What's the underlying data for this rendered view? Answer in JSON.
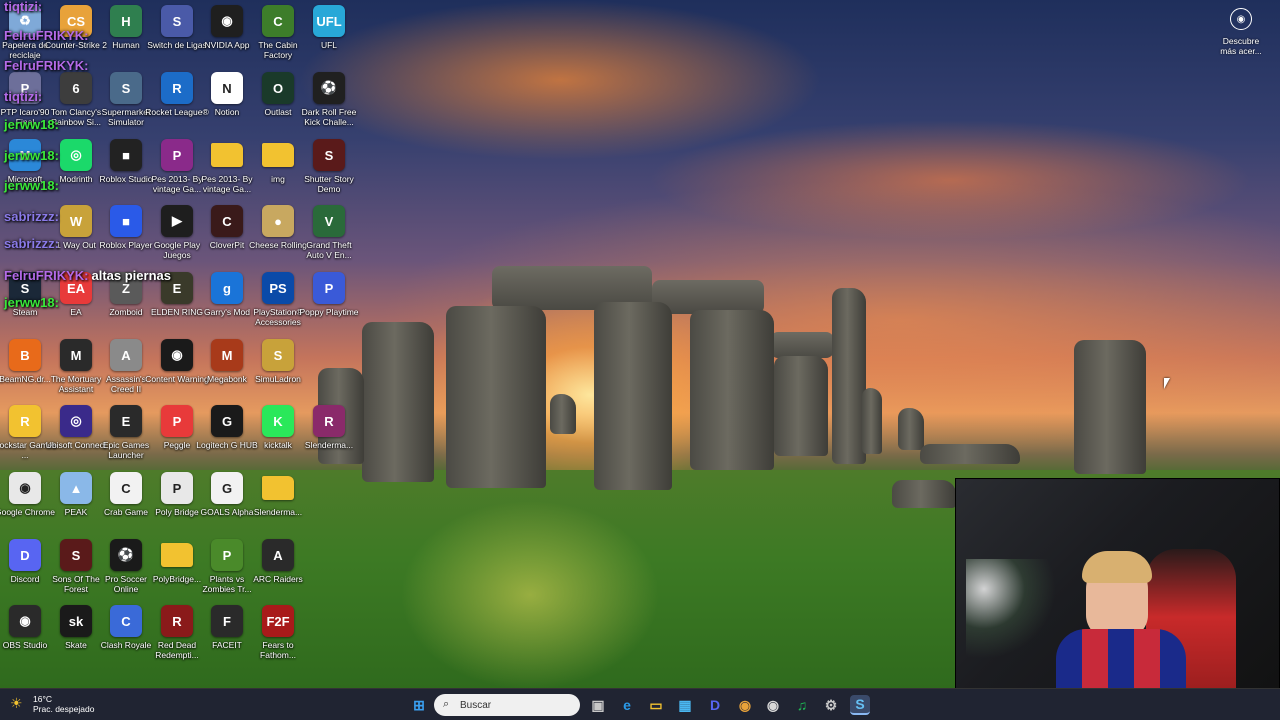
{
  "desktop": {
    "icons": [
      {
        "label": "Papelera de reciclaje",
        "icon": "recycle-bin-icon",
        "color": "#7fa9d8",
        "glyph": "♻",
        "col": 0,
        "row": 0
      },
      {
        "label": "Counter-Strike 2",
        "icon": "counter-strike-icon",
        "color": "#e8a23a",
        "glyph": "CS",
        "col": 1,
        "row": 0
      },
      {
        "label": "Human",
        "icon": "human-icon",
        "color": "#2f7f4f",
        "glyph": "H",
        "col": 2,
        "row": 0
      },
      {
        "label": "Switch de Ligas",
        "icon": "switch-ligas-icon",
        "color": "#4a5aa8",
        "glyph": "S",
        "col": 3,
        "row": 0
      },
      {
        "label": "NVIDIA App",
        "icon": "nvidia-icon",
        "color": "#1f1f1f",
        "glyph": "◉",
        "col": 4,
        "row": 0
      },
      {
        "label": "The Cabin Factory",
        "icon": "cabin-factory-icon",
        "color": "#3d7d2a",
        "glyph": "C",
        "col": 5,
        "row": 0
      },
      {
        "label": "UFL",
        "icon": "ufl-icon",
        "color": "#28a8d8",
        "glyph": "UFL",
        "col": 6,
        "row": 0
      },
      {
        "label": "PTP Icaro'90 Final",
        "icon": "ptp-icon",
        "color": "#6d6f9a",
        "glyph": "P",
        "col": 0,
        "row": 1
      },
      {
        "label": "Tom Clancy's Rainbow Si...",
        "icon": "rainbow-six-icon",
        "color": "#3d3d3d",
        "glyph": "6",
        "col": 1,
        "row": 1
      },
      {
        "label": "Supermarket Simulator",
        "icon": "supermarket-icon",
        "color": "#4a6a8a",
        "glyph": "S",
        "col": 2,
        "row": 1
      },
      {
        "label": "Rocket League®",
        "icon": "rocket-league-icon",
        "color": "#1c6cc8",
        "glyph": "R",
        "col": 3,
        "row": 1
      },
      {
        "label": "Notion",
        "icon": "notion-icon",
        "color": "#ffffff",
        "glyph": "N",
        "col": 4,
        "row": 1
      },
      {
        "label": "Outlast",
        "icon": "outlast-icon",
        "color": "#1a3a2a",
        "glyph": "O",
        "col": 5,
        "row": 1
      },
      {
        "label": "Dark Roll Free Kick Challe...",
        "icon": "soccer-ball-icon",
        "color": "#202020",
        "glyph": "⚽",
        "col": 6,
        "row": 1
      },
      {
        "label": "Microsoft",
        "icon": "microsoft-icon",
        "color": "#2b88d8",
        "glyph": "M",
        "col": 0,
        "row": 2
      },
      {
        "label": "Modrinth",
        "icon": "modrinth-icon",
        "color": "#1bd96a",
        "glyph": "◎",
        "col": 1,
        "row": 2
      },
      {
        "label": "Roblox Studio",
        "icon": "roblox-studio-icon",
        "color": "#222222",
        "glyph": "■",
        "col": 2,
        "row": 2
      },
      {
        "label": "Pes 2013- By vintage Ga...",
        "icon": "pes-icon",
        "color": "#8a2a8a",
        "glyph": "P",
        "col": 3,
        "row": 2
      },
      {
        "label": "Pes 2013- By vintage Ga...",
        "icon": "folder-icon",
        "color": "#f2c230",
        "glyph": "",
        "col": 4,
        "row": 2
      },
      {
        "label": "img",
        "icon": "folder-icon",
        "color": "#f2c230",
        "glyph": "",
        "col": 5,
        "row": 2
      },
      {
        "label": "Shutter Story Demo",
        "icon": "shutter-story-icon",
        "color": "#5a1a1a",
        "glyph": "S",
        "col": 6,
        "row": 2
      },
      {
        "label": "1 Way Out",
        "icon": "way-out-icon",
        "color": "#c8a23a",
        "glyph": "W",
        "col": 1,
        "row": 3
      },
      {
        "label": "Roblox Player",
        "icon": "roblox-icon",
        "color": "#2a5ae8",
        "glyph": "■",
        "col": 2,
        "row": 3
      },
      {
        "label": "Google Play Juegos",
        "icon": "google-play-icon",
        "color": "#1e1e1e",
        "glyph": "▶",
        "col": 3,
        "row": 3
      },
      {
        "label": "CloverPit",
        "icon": "cloverpit-icon",
        "color": "#3a1a1a",
        "glyph": "C",
        "col": 4,
        "row": 3
      },
      {
        "label": "Cheese Rolling",
        "icon": "cheese-rolling-icon",
        "color": "#c8a860",
        "glyph": "●",
        "col": 5,
        "row": 3
      },
      {
        "label": "Grand Theft Auto V En...",
        "icon": "gta-icon",
        "color": "#2a6a3a",
        "glyph": "V",
        "col": 6,
        "row": 3
      },
      {
        "label": "Steam",
        "icon": "steam-icon",
        "color": "#1b2838",
        "glyph": "S",
        "col": 0,
        "row": 4
      },
      {
        "label": "EA",
        "icon": "ea-icon",
        "color": "#e83a3a",
        "glyph": "EA",
        "col": 1,
        "row": 4
      },
      {
        "label": "Zomboid",
        "icon": "zomboid-icon",
        "color": "#5a5a5a",
        "glyph": "Z",
        "col": 2,
        "row": 4
      },
      {
        "label": "ELDEN RING",
        "icon": "elden-ring-icon",
        "color": "#3a3a2a",
        "glyph": "E",
        "col": 3,
        "row": 4
      },
      {
        "label": "Garry's Mod",
        "icon": "garrys-mod-icon",
        "color": "#1a74d8",
        "glyph": "g",
        "col": 4,
        "row": 4
      },
      {
        "label": "PlayStation® Accessories",
        "icon": "playstation-icon",
        "color": "#0a4aa8",
        "glyph": "PS",
        "col": 5,
        "row": 4
      },
      {
        "label": "Poppy Playtime",
        "icon": "poppy-playtime-icon",
        "color": "#3a5ad8",
        "glyph": "P",
        "col": 6,
        "row": 4
      },
      {
        "label": "BeamNG.dr...",
        "icon": "beamng-icon",
        "color": "#e86a1a",
        "glyph": "B",
        "col": 0,
        "row": 5
      },
      {
        "label": "The Mortuary Assistant",
        "icon": "mortuary-icon",
        "color": "#2a2a2a",
        "glyph": "M",
        "col": 1,
        "row": 5
      },
      {
        "label": "Assassin's Creed II",
        "icon": "assassins-creed-icon",
        "color": "#8a8a8a",
        "glyph": "A",
        "col": 2,
        "row": 5
      },
      {
        "label": "Content Warning",
        "icon": "content-warning-icon",
        "color": "#1a1a1a",
        "glyph": "◉",
        "col": 3,
        "row": 5
      },
      {
        "label": "Megabonk",
        "icon": "megabonk-icon",
        "color": "#a83a1a",
        "glyph": "M",
        "col": 4,
        "row": 5
      },
      {
        "label": "SimuLadron",
        "icon": "simuladron-icon",
        "color": "#c8a23a",
        "glyph": "S",
        "col": 5,
        "row": 5
      },
      {
        "label": "Rockstar Games ...",
        "icon": "rockstar-icon",
        "color": "#f2c230",
        "glyph": "R",
        "col": 0,
        "row": 6
      },
      {
        "label": "Ubisoft Connect",
        "icon": "ubisoft-icon",
        "color": "#3a2a8a",
        "glyph": "◎",
        "col": 1,
        "row": 6
      },
      {
        "label": "Epic Games Launcher",
        "icon": "epic-games-icon",
        "color": "#2a2a2a",
        "glyph": "E",
        "col": 2,
        "row": 6
      },
      {
        "label": "Peggle",
        "icon": "peggle-icon",
        "color": "#e83a3a",
        "glyph": "P",
        "col": 3,
        "row": 6
      },
      {
        "label": "Logitech G HUB",
        "icon": "logitech-icon",
        "color": "#1a1a1a",
        "glyph": "G",
        "col": 4,
        "row": 6
      },
      {
        "label": "kicktalk",
        "icon": "kicktalk-icon",
        "color": "#2ae85a",
        "glyph": "K",
        "col": 5,
        "row": 6
      },
      {
        "label": "Slenderma...",
        "icon": "winrar-icon",
        "color": "#8a2a6a",
        "glyph": "R",
        "col": 6,
        "row": 6
      },
      {
        "label": "Google Chrome",
        "icon": "chrome-icon",
        "color": "#e8e8e8",
        "glyph": "◉",
        "col": 0,
        "row": 7
      },
      {
        "label": "PEAK",
        "icon": "peak-icon",
        "color": "#8ab8e8",
        "glyph": "▲",
        "col": 1,
        "row": 7
      },
      {
        "label": "Crab Game",
        "icon": "crab-game-icon",
        "color": "#f2f2f2",
        "glyph": "C",
        "col": 2,
        "row": 7
      },
      {
        "label": "Poly Bridge",
        "icon": "poly-bridge-icon",
        "color": "#e8e8e8",
        "glyph": "P",
        "col": 3,
        "row": 7
      },
      {
        "label": "GOALS Alpha",
        "icon": "goals-icon",
        "color": "#f2f2f2",
        "glyph": "G",
        "col": 4,
        "row": 7
      },
      {
        "label": "Slenderma...",
        "icon": "folder-icon",
        "color": "#f2c230",
        "glyph": "",
        "col": 5,
        "row": 7
      },
      {
        "label": "Discord",
        "icon": "discord-icon",
        "color": "#5865f2",
        "glyph": "D",
        "col": 0,
        "row": 8
      },
      {
        "label": "Sons Of The Forest",
        "icon": "sons-forest-icon",
        "color": "#5a1a1a",
        "glyph": "S",
        "col": 1,
        "row": 8
      },
      {
        "label": "Pro Soccer Online",
        "icon": "pro-soccer-icon",
        "color": "#1a1a1a",
        "glyph": "⚽",
        "col": 2,
        "row": 8
      },
      {
        "label": "PolyBridge...",
        "icon": "folder-icon",
        "color": "#f2c230",
        "glyph": "",
        "col": 3,
        "row": 8
      },
      {
        "label": "Plants vs Zombies Tr...",
        "icon": "pvz-icon",
        "color": "#4a8a2a",
        "glyph": "P",
        "col": 4,
        "row": 8
      },
      {
        "label": "ARC Raiders",
        "icon": "arc-raiders-icon",
        "color": "#2a2a2a",
        "glyph": "A",
        "col": 5,
        "row": 8
      },
      {
        "label": "OBS Studio",
        "icon": "obs-icon",
        "color": "#2a2a2a",
        "glyph": "◉",
        "col": 0,
        "row": 9
      },
      {
        "label": "Skate",
        "icon": "skate-icon",
        "color": "#1a1a1a",
        "glyph": "sk",
        "col": 1,
        "row": 9
      },
      {
        "label": "Clash Royale",
        "icon": "clash-royale-icon",
        "color": "#3a6ad8",
        "glyph": "C",
        "col": 2,
        "row": 9
      },
      {
        "label": "Red Dead Redempti...",
        "icon": "red-dead-icon",
        "color": "#8a1a1a",
        "glyph": "R",
        "col": 3,
        "row": 9
      },
      {
        "label": "FACEIT",
        "icon": "faceit-icon",
        "color": "#2a2a2a",
        "glyph": "F",
        "col": 4,
        "row": 9
      },
      {
        "label": "Fears to Fathom...",
        "icon": "fears-fathom-icon",
        "color": "#a81a1a",
        "glyph": "F2F",
        "col": 5,
        "row": 9
      }
    ],
    "discover": {
      "label": "Descubre más acer...",
      "icon": "camera-icon"
    }
  },
  "chat": [
    {
      "user": "tiqtizi:",
      "msg": "",
      "color": "#b46ae8"
    },
    {
      "user": "FelruFRIKYK:",
      "msg": "",
      "color": "#b46ae8"
    },
    {
      "user": "FelruFRIKYK:",
      "msg": "",
      "color": "#b46ae8"
    },
    {
      "user": "tiqtizi:",
      "msg": "",
      "color": "#b46ae8"
    },
    {
      "user": "jerww18:",
      "msg": "",
      "color": "#3ae83a"
    },
    {
      "user": "jerww18:",
      "msg": "",
      "color": "#3ae83a"
    },
    {
      "user": "jerww18:",
      "msg": "",
      "color": "#3ae83a"
    },
    {
      "user": "sabrizzz:",
      "msg": "",
      "color": "#8a7ae8"
    },
    {
      "user": "sabrizzz:",
      "msg": "",
      "color": "#8a7ae8"
    },
    {
      "user": "FelruFRIKYK:",
      "msg": "altas piernas",
      "color": "#b46ae8"
    },
    {
      "user": "jerww18:",
      "msg": "",
      "color": "#3ae83a"
    }
  ],
  "taskbar": {
    "weather_temp": "16°C",
    "weather_desc": "Prac. despejado",
    "search_placeholder": "Buscar",
    "apps": [
      {
        "icon": "windows-start-icon",
        "glyph": "⊞",
        "color": "#3aa0f2"
      },
      {
        "icon": "task-view-icon",
        "glyph": "▣",
        "color": "#c8c8c8"
      },
      {
        "icon": "edge-icon",
        "glyph": "e",
        "color": "#2a9ae8"
      },
      {
        "icon": "file-explorer-icon",
        "glyph": "▭",
        "color": "#f2c230"
      },
      {
        "icon": "microsoft-store-icon",
        "glyph": "▦",
        "color": "#4ab8f2"
      },
      {
        "icon": "discord-icon",
        "glyph": "D",
        "color": "#5865f2"
      },
      {
        "icon": "chrome-icon",
        "glyph": "◉",
        "color": "#e8a23a"
      },
      {
        "icon": "obs-icon",
        "glyph": "◉",
        "color": "#d8d8d8"
      },
      {
        "icon": "spotify-icon",
        "glyph": "♫",
        "color": "#1db954"
      },
      {
        "icon": "settings-icon",
        "glyph": "⚙",
        "color": "#c8c8c8"
      },
      {
        "icon": "steam-icon",
        "glyph": "S",
        "color": "#66c0f4"
      }
    ]
  }
}
